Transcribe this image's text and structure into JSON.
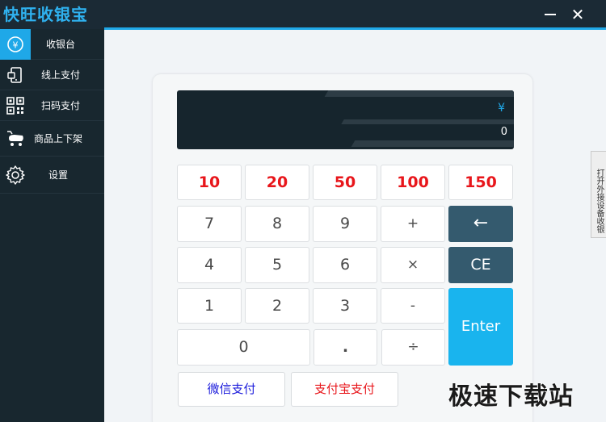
{
  "app": {
    "logo_text": "快旺收银宝"
  },
  "window": {
    "minimize_icon": "minimize-icon",
    "close_label": "✕"
  },
  "sidebar": {
    "items": [
      {
        "label": "收银台",
        "icon": "yen-circle-icon",
        "active": true
      },
      {
        "label": "线上支付",
        "icon": "phone-pay-icon",
        "active": false
      },
      {
        "label": "扫码支付",
        "icon": "qr-code-icon",
        "active": false
      },
      {
        "label": "商品上下架",
        "icon": "cart-icon",
        "active": false
      },
      {
        "label": "设置",
        "icon": "gear-icon",
        "active": false
      }
    ]
  },
  "display": {
    "currency": "¥",
    "amount": "0"
  },
  "keypad": {
    "quick_amounts": [
      "10",
      "20",
      "50",
      "100",
      "150"
    ],
    "row2": [
      "7",
      "8",
      "9",
      "+"
    ],
    "row3": [
      "4",
      "5",
      "6",
      "×"
    ],
    "row4": [
      "1",
      "2",
      "3",
      "-"
    ],
    "row5": [
      "0",
      ".",
      "÷"
    ],
    "backspace": "←",
    "clear": "CE",
    "enter": "Enter"
  },
  "payment": {
    "wechat_label": "微信支付",
    "alipay_label": "支付宝支付"
  },
  "side_tab": {
    "label": "打开外接设备收银"
  },
  "watermark": "极速下载站",
  "colors": {
    "accent": "#1fa8e8",
    "sidebar_bg": "#18272f",
    "quick_amount": "#e8161b",
    "dark_key": "#345a6e",
    "enter_key": "#19b4ee",
    "wechat_text": "#1a1adb",
    "alipay_text": "#e8161b"
  }
}
